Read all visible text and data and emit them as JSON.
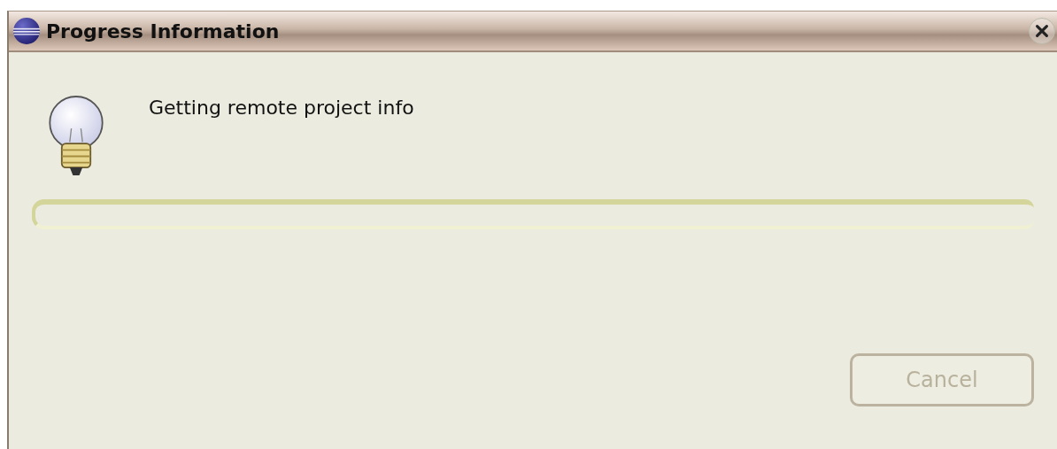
{
  "window": {
    "title": "Progress Information"
  },
  "message": "Getting remote project info",
  "buttons": [
    {
      "label": "Cancel",
      "disabled": true
    }
  ]
}
